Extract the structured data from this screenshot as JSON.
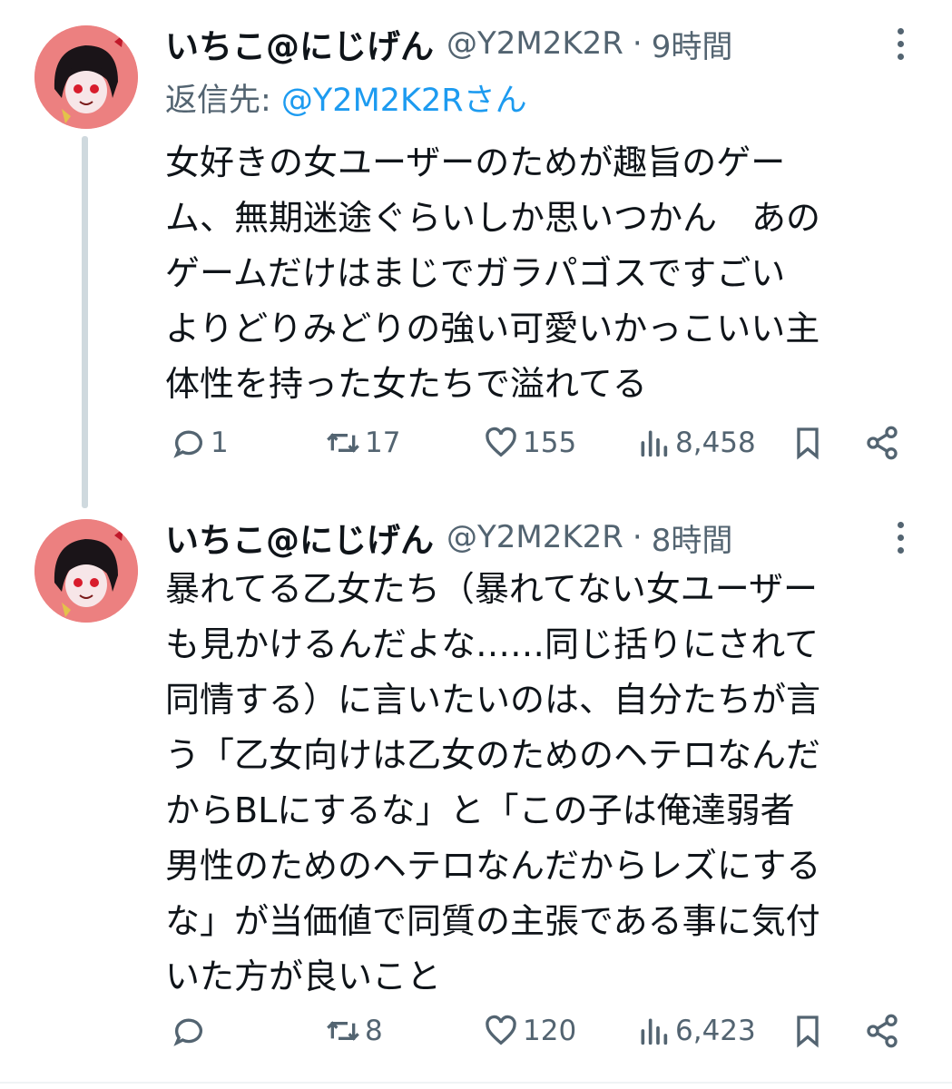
{
  "tweets": [
    {
      "display_name": "いちこ@にじげん",
      "handle": "@Y2M2K2R",
      "separator": "·",
      "time": "9時間",
      "reply_label": "返信先: ",
      "reply_handle": "@Y2M2K2Rさん",
      "lines": [
        "女好きの女ユーザーのためが趣旨のゲー",
        "ム、無期迷途ぐらいしか思いつかん　あの",
        "ゲームだけはまじでガラパゴスですごい",
        "よりどりみどりの強い可愛いかっこいい主",
        "体性を持った女たちで溢れてる"
      ],
      "replies": "1",
      "retweets": "17",
      "likes": "155",
      "views": "8,458"
    },
    {
      "display_name": "いちこ@にじげん",
      "handle": "@Y2M2K2R",
      "separator": "·",
      "time": "8時間",
      "lines": [
        "暴れてる乙女たち（暴れてない女ユーザー",
        "も見かけるんだよな……同じ括りにされて",
        "同情する）に言いたいのは、自分たちが言",
        "う「乙女向けは乙女のためのヘテロなんだ",
        "からBLにするな」と「この子は俺達弱者",
        "男性のためのヘテロなんだからレズにする",
        "な」が当価値で同質の主張である事に気付",
        "いた方が良いこと"
      ],
      "replies": "",
      "retweets": "8",
      "likes": "120",
      "views": "6,423"
    }
  ],
  "icons": {
    "reply": "reply-icon",
    "retweet": "retweet-icon",
    "like": "heart-icon",
    "views": "views-icon",
    "bookmark": "bookmark-icon",
    "share": "share-icon",
    "more": "more-icon",
    "avatar": "avatar"
  },
  "colors": {
    "text": "#0f1419",
    "secondary": "#536471",
    "link": "#1d9bf0",
    "thread_line": "#cfd9de",
    "avatar_bg": "#ec8080"
  }
}
